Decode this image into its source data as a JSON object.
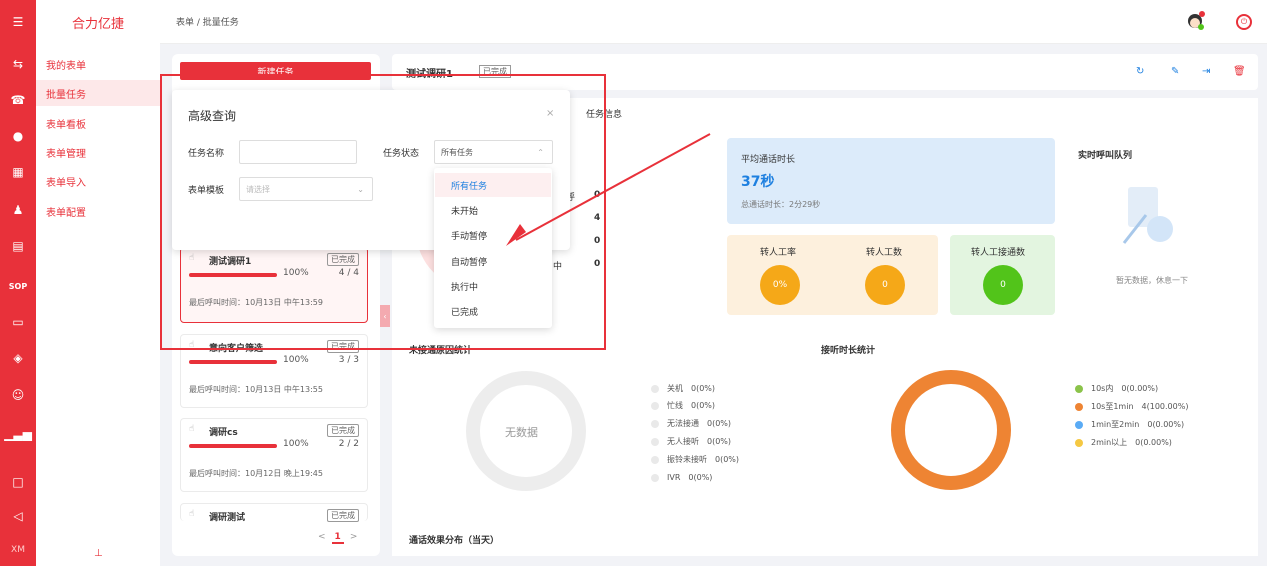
{
  "app": {
    "name": "合力亿捷",
    "user_initials": "XM"
  },
  "breadcrumb": "表单 / 批量任务",
  "sidebar": {
    "items": [
      "我的表单",
      "批量任务",
      "表单看板",
      "表单管理",
      "表单导入",
      "表单配置"
    ],
    "active": 1
  },
  "rail": {
    "sop": "SOP"
  },
  "left_panel": {
    "new_task": "新建任务",
    "tasks": [
      {
        "name": "测试调研1",
        "status": "已完成",
        "progress": 1.0,
        "pct": "100%",
        "count": "4 / 4",
        "last": "最后呼叫时间：10月13日 中午13:59"
      },
      {
        "name": "意向客户筛选",
        "status": "已完成",
        "progress": 1.0,
        "pct": "100%",
        "count": "3 / 3",
        "last": "最后呼叫时间：10月13日 中午13:55"
      },
      {
        "name": "调研cs",
        "status": "已完成",
        "progress": 1.0,
        "pct": "100%",
        "count": "2 / 2",
        "last": "最后呼叫时间：10月12日 晚上19:45"
      },
      {
        "name": "调研测试",
        "status": "已完成"
      }
    ],
    "pager": {
      "prev": "<",
      "current": "1",
      "next": ">"
    }
  },
  "main": {
    "title": "测试调研1",
    "badge": "已完成",
    "tab": "任务信息",
    "partial_rows": [
      {
        "label": "呼",
        "value": "0"
      },
      {
        "value": "4"
      },
      {
        "value": "0"
      },
      {
        "label": "中",
        "value": "0"
      }
    ],
    "avg": {
      "label": "平均通话时长",
      "value": "37秒",
      "total": "总通话时长：2分29秒"
    },
    "metrics": [
      {
        "label": "转人工率",
        "value": "0%",
        "color": "#f5a818"
      },
      {
        "label": "转人工数",
        "value": "0",
        "color": "#f5a818"
      },
      {
        "label": "转人工接通数",
        "value": "0",
        "color": "#52c41a"
      }
    ],
    "queue": {
      "title": "实时呼叫队列",
      "empty": "暂无数据，休息一下"
    },
    "unanswered": {
      "title": "未接通原因统计",
      "nodata": "无数据",
      "legend": [
        "关机　0(0%)",
        "忙线　0(0%)",
        "无法接通　0(0%)",
        "无人接听　0(0%)",
        "振铃未接听　0(0%)",
        "IVR　0(0%)"
      ]
    },
    "duration": {
      "title": "接听时长统计",
      "legend": [
        {
          "text": "10s内　0(0.00%)",
          "color": "#8bc34a"
        },
        {
          "text": "10s至1min　4(100.00%)",
          "color": "#ee8433"
        },
        {
          "text": "1min至2min　0(0.00%)",
          "color": "#5aabf5"
        },
        {
          "text": "2min以上　0(0.00%)",
          "color": "#f5c842"
        }
      ]
    },
    "bottom_title": "通话效果分布（当天）"
  },
  "modal": {
    "title": "高级查询",
    "close": "×",
    "name_label": "任务名称",
    "status_label": "任务状态",
    "status_value": "所有任务",
    "template_label": "表单模板",
    "template_placeholder": "请选择",
    "options": [
      "所有任务",
      "未开始",
      "手动暂停",
      "自动暂停",
      "执行中",
      "已完成"
    ]
  }
}
